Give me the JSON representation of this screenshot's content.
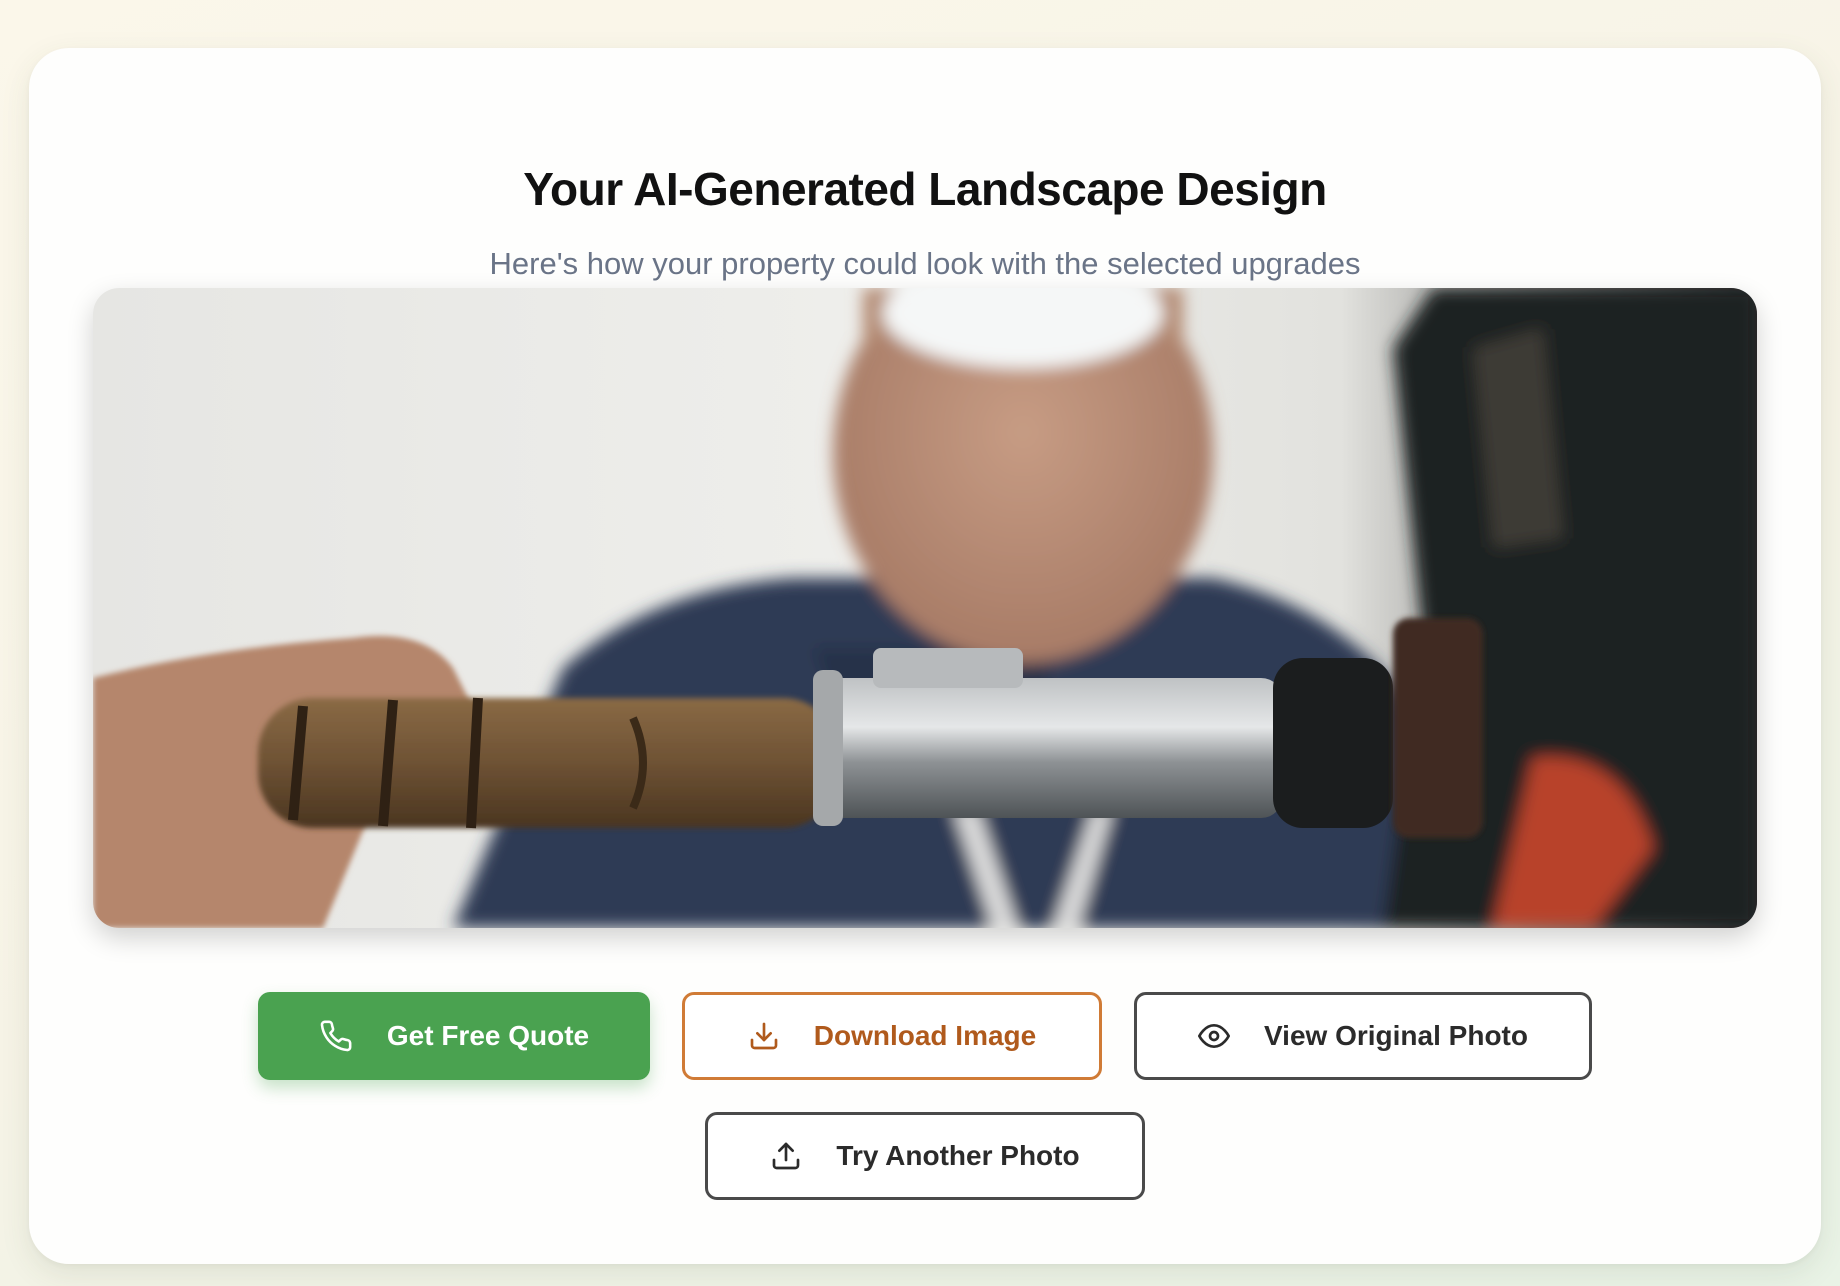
{
  "result": {
    "title": "Your AI-Generated Landscape Design",
    "subtitle": "Here's how your property could look with the selected upgrades"
  },
  "actions": {
    "get_quote": {
      "label": "Get Free Quote",
      "icon": "phone-icon",
      "color": "#4aa250"
    },
    "download": {
      "label": "Download Image",
      "icon": "download-icon",
      "color": "#d07b36"
    },
    "view_original": {
      "label": "View Original Photo",
      "icon": "eye-icon"
    },
    "try_another": {
      "label": "Try Another Photo",
      "icon": "upload-icon"
    }
  }
}
